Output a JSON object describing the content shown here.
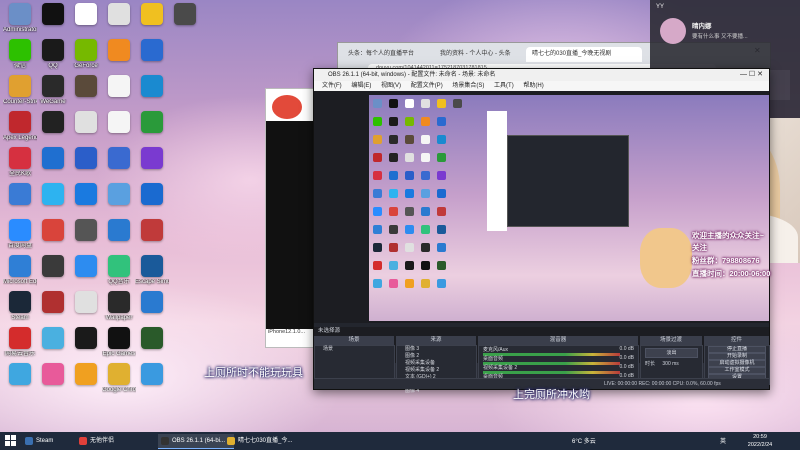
{
  "desktop": {
    "icons": [
      {
        "label": "Administrator",
        "color": "#6b8fc7"
      },
      {
        "label": "微信",
        "color": "#2dc100"
      },
      {
        "label": "Counter-Strike",
        "color": "#e0a030"
      },
      {
        "label": "Apex Legends",
        "color": "#c0282d"
      },
      {
        "label": "全民K歌",
        "color": "#d63040"
      },
      {
        "label": "",
        "color": "#3a7bd5"
      },
      {
        "label": "百度网盘",
        "color": "#2a8cff"
      },
      {
        "label": "Microsoft Edge",
        "color": "#2f7fd6"
      },
      {
        "label": "Steam",
        "color": "#1b2838"
      },
      {
        "label": "网易云音乐",
        "color": "#d42c2c"
      },
      {
        "label": "",
        "color": "#3fa7e0"
      },
      {
        "label": "",
        "color": "#111111"
      },
      {
        "label": "QQ",
        "color": "#1a1a1a"
      },
      {
        "label": "WeGame",
        "color": "#2a2a2a"
      },
      {
        "label": "",
        "color": "#222222"
      },
      {
        "label": "",
        "color": "#1f6fd0"
      },
      {
        "label": "",
        "color": "#2db3f0"
      },
      {
        "label": "",
        "color": "#d9443b"
      },
      {
        "label": "",
        "color": "#3a3a3a"
      },
      {
        "label": "",
        "color": "#b03030"
      },
      {
        "label": "",
        "color": "#4ab0e0"
      },
      {
        "label": "",
        "color": "#e85a9a"
      },
      {
        "label": "",
        "color": "#ffffff"
      },
      {
        "label": "GeForce",
        "color": "#76b900"
      },
      {
        "label": "",
        "color": "#5a4a3a"
      },
      {
        "label": "",
        "color": "#e0e0e0"
      },
      {
        "label": "",
        "color": "#2b5ec9"
      },
      {
        "label": "",
        "color": "#1a7ae0"
      },
      {
        "label": "",
        "color": "#555555"
      },
      {
        "label": "",
        "color": "#2d8cf0"
      },
      {
        "label": "",
        "color": "#e0e0e0"
      },
      {
        "label": "",
        "color": "#1a1a1a"
      },
      {
        "label": "",
        "color": "#f0a020"
      },
      {
        "label": "",
        "color": "#e0e0e0"
      },
      {
        "label": "",
        "color": "#f08a20"
      },
      {
        "label": "",
        "color": "#f5f5f5"
      },
      {
        "label": "",
        "color": "#f5f5f5"
      },
      {
        "label": "",
        "color": "#3a6ad0"
      },
      {
        "label": "",
        "color": "#5aa0e0"
      },
      {
        "label": "",
        "color": "#2a7ad0"
      },
      {
        "label": "QQ音乐",
        "color": "#31c27c"
      },
      {
        "label": "Wallpaper",
        "color": "#2a2a2a"
      },
      {
        "label": "Epic Games",
        "color": "#111111"
      },
      {
        "label": "Google Chrome",
        "color": "#e0b030"
      },
      {
        "label": "",
        "color": "#f0c020"
      },
      {
        "label": "",
        "color": "#2a6ad0"
      },
      {
        "label": "",
        "color": "#1a8ad0"
      },
      {
        "label": "",
        "color": "#2a9a3a"
      },
      {
        "label": "",
        "color": "#7a3ad0"
      },
      {
        "label": "",
        "color": "#1a6ad0"
      },
      {
        "label": "",
        "color": "#c03a3a"
      },
      {
        "label": "Escape Simulator",
        "color": "#1a5a9a"
      },
      {
        "label": "",
        "color": "#2a7ad0"
      },
      {
        "label": "",
        "color": "#2a5a2a"
      },
      {
        "label": "",
        "color": "#3a9ae0"
      },
      {
        "label": "",
        "color": "#4a4a4a"
      }
    ]
  },
  "browser": {
    "tabs": [
      "头条：每个人的直播平台",
      "我的资料 - 个人中心 - 头条",
      "晴七七的030直播_今晚无视剧"
    ],
    "address": "douyu.com/1041442011=1752187031781815"
  },
  "obs": {
    "title": "OBS 26.1.1 (64-bit, windows) - 配置文件: 未命名 - 场景: 未命名",
    "menu": [
      "文件(F)",
      "编辑(E)",
      "视图(V)",
      "配置文件(P)",
      "场景集合(S)",
      "工具(T)",
      "帮助(H)"
    ],
    "no_source": "未选择源",
    "panels": {
      "scenes": "场景",
      "sources": "来源",
      "mixer": "混音器",
      "transitions": "场景过渡",
      "controls": "控件"
    },
    "scene_item": "场景",
    "sources": [
      "图像 3",
      "图像 2",
      "视频采集设备",
      "视频采集设备 2",
      "文本 (GDI+) 2",
      "视频采集设备 3",
      "图像 4"
    ],
    "mixer": [
      {
        "name": "麦克风/Aux",
        "level": "0.0 dB"
      },
      {
        "name": "桌面音频",
        "level": "0.0 dB"
      },
      {
        "name": "视频采集设备 2",
        "level": "0.0 dB"
      },
      {
        "name": "桌面音频",
        "level": "0.0 dB"
      }
    ],
    "transition": {
      "type": "淡出",
      "duration_label": "时长",
      "duration": "300 ms"
    },
    "controls": [
      "停止直播",
      "开始录制",
      "启动虚拟摄像机",
      "工作室模式",
      "设置",
      "退出"
    ],
    "status": "LIVE: 00:00:00    REC: 00:00:00    CPU: 0.0%, 60.00 fps"
  },
  "stream_overlay": {
    "lines": [
      "欢迎主播的众众关注~",
      "关注",
      "粉丝群",
      "直播时间：20:00-06:00"
    ],
    "fan_group_number": "798808676",
    "subtitle_left": "上厕所时不能玩玩具",
    "subtitle_right": "上完厕所冲水哟"
  },
  "chat": {
    "user": "YY",
    "name": "晴内娜",
    "message": "要有什么事 又不要播..."
  },
  "capture_window": {
    "label": "iPhone12.1.0..."
  },
  "taskbar": {
    "items": [
      {
        "label": "Steam",
        "color": "#3a6fb0"
      },
      {
        "label": "无他伴侣",
        "color": "#e0403a"
      },
      {
        "label": "OBS 26.1.1 (64-bi...",
        "color": "#333333"
      },
      {
        "label": "晴七七030直播_今...",
        "color": "#e0b030"
      }
    ],
    "weather": "6°C 多云",
    "ime": "英",
    "time": "20:59",
    "date": "2022/2/24"
  },
  "colors": {
    "taskbar": "#1f2a3c",
    "obs_bg": "#2b2e38",
    "overlay_stroke": "#7a2c6b"
  }
}
